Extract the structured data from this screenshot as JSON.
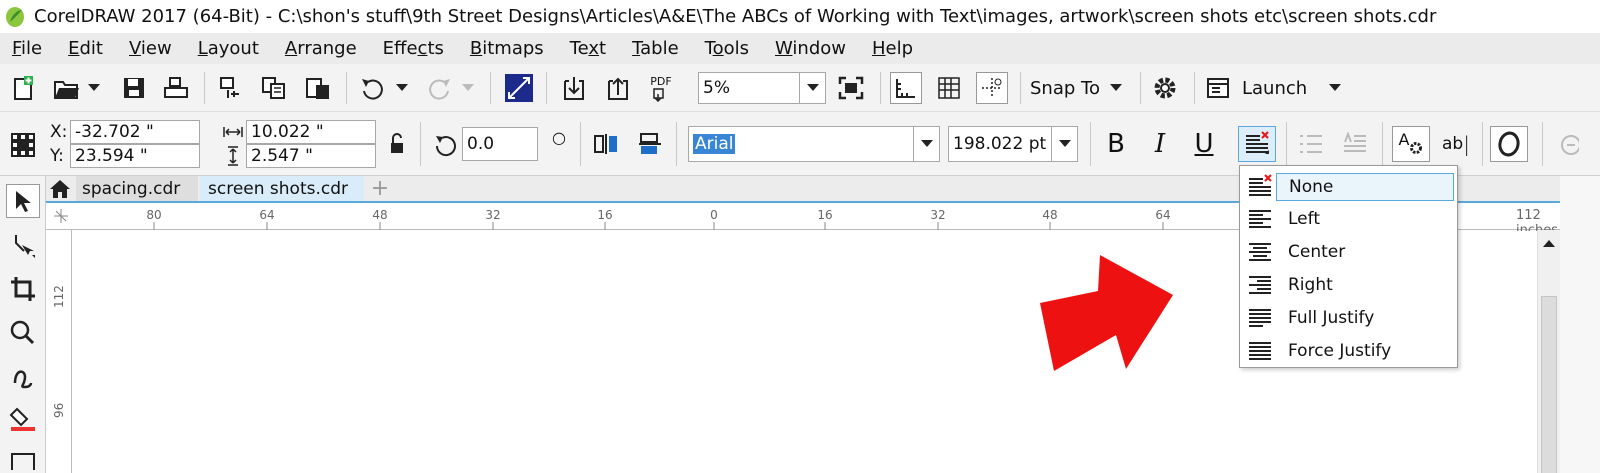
{
  "window": {
    "title": "CorelDRAW 2017 (64-Bit) - C:\\shon's stuff\\9th Street Designs\\Articles\\A&E\\The ABCs of Working with Text\\images, artwork\\screen shots etc\\screen shots.cdr"
  },
  "menu": {
    "items": [
      {
        "pre": "",
        "u": "F",
        "post": "ile"
      },
      {
        "pre": "",
        "u": "E",
        "post": "dit"
      },
      {
        "pre": "",
        "u": "V",
        "post": "iew"
      },
      {
        "pre": "",
        "u": "L",
        "post": "ayout"
      },
      {
        "pre": "",
        "u": "A",
        "post": "rrange"
      },
      {
        "pre": "Effe",
        "u": "c",
        "post": "ts"
      },
      {
        "pre": "",
        "u": "B",
        "post": "itmaps"
      },
      {
        "pre": "Te",
        "u": "x",
        "post": "t"
      },
      {
        "pre": "",
        "u": "T",
        "post": "able"
      },
      {
        "pre": "T",
        "u": "o",
        "post": "ols"
      },
      {
        "pre": "",
        "u": "W",
        "post": "indow"
      },
      {
        "pre": "",
        "u": "H",
        "post": "elp"
      }
    ]
  },
  "toolbar": {
    "zoom_value": "5%",
    "snap_label": "Snap To",
    "launch_label": "Launch",
    "pdf_label": "PDF"
  },
  "property_bar": {
    "x_label": "X:",
    "x_value": "-32.702 \"",
    "y_label": "Y:",
    "y_value": "23.594 \"",
    "width_value": "10.022 \"",
    "height_value": "2.547 \"",
    "rotation_value": "0.0",
    "degree_symbol": "○",
    "font_name": "Arial",
    "font_size": "198.022 pt",
    "bold_label": "B",
    "italic_label": "I",
    "underline_label": "U",
    "char_label": "A",
    "edit_text_label": "ab"
  },
  "tabs": [
    {
      "label": "spacing.cdr"
    },
    {
      "label": "screen shots.cdr"
    }
  ],
  "ruler": {
    "h_ticks": [
      "80",
      "64",
      "48",
      "32",
      "16",
      "0",
      "16",
      "32",
      "48",
      "64"
    ],
    "unit_label": "112 inches",
    "v_ticks": [
      "112",
      "96"
    ]
  },
  "alignment_menu": {
    "items": [
      {
        "label": "None"
      },
      {
        "label": "Left"
      },
      {
        "label": "Center"
      },
      {
        "label": "Right"
      },
      {
        "label": "Full Justify"
      },
      {
        "label": "Force Justify"
      }
    ]
  },
  "colors": {
    "arrow": "#ee1111",
    "accent": "#5aa9dc",
    "selection": "#3a86d6"
  }
}
